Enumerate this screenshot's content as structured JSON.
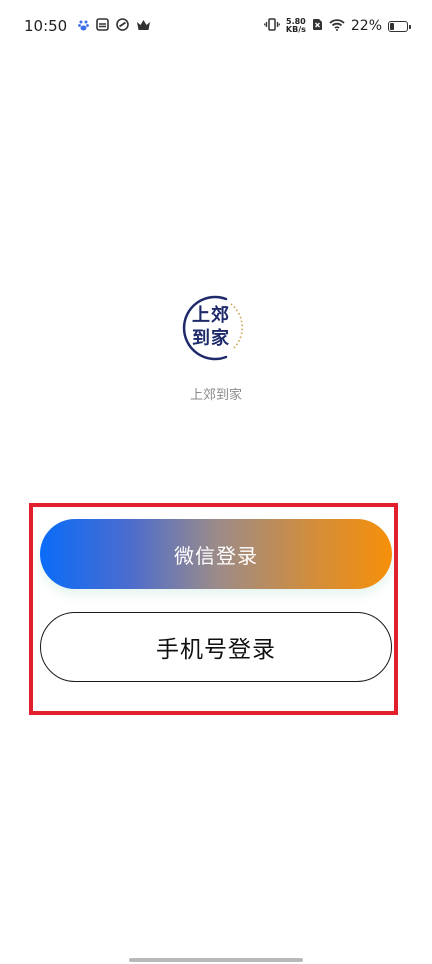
{
  "status_bar": {
    "time": "10:50",
    "net_speed_value": "5.80",
    "net_speed_unit": "KB/s",
    "battery_percent": "22%",
    "battery_level": 0.22
  },
  "logo": {
    "line1": "上郊",
    "line2": "到家",
    "ring_color": "#1f2a6b",
    "accent_color": "#c9a24b"
  },
  "app_name": "上郊到家",
  "buttons": {
    "wechat_login": "微信登录",
    "phone_login": "手机号登录"
  },
  "colors": {
    "gradient_start": "#0a6cf8",
    "gradient_end": "#f7900a",
    "highlight": "#e21f2d"
  }
}
